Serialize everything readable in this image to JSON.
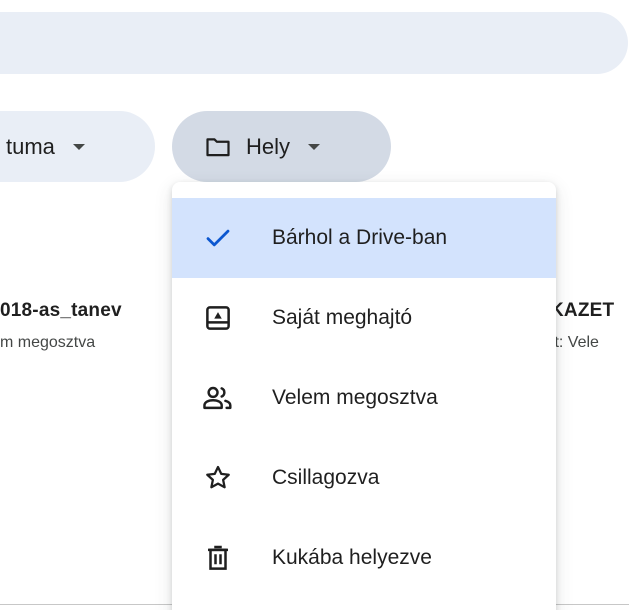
{
  "search": {},
  "filters": {
    "date_chip_label": "tuma",
    "place_chip_label": "Hely"
  },
  "files": {
    "left_name": "018-as_tanev",
    "left_sub": "m megosztva",
    "right_name": "KAZET",
    "right_sub": "tt: Vele"
  },
  "menu": {
    "items": [
      {
        "label": "Bárhol a Drive-ban",
        "icon": "check-icon",
        "selected": true
      },
      {
        "label": "Saját meghajtó",
        "icon": "drive-icon",
        "selected": false
      },
      {
        "label": "Velem megosztva",
        "icon": "people-icon",
        "selected": false
      },
      {
        "label": "Csillagozva",
        "icon": "star-icon",
        "selected": false
      },
      {
        "label": "Kukába helyezve",
        "icon": "trash-icon",
        "selected": false
      }
    ]
  },
  "colors": {
    "chip_bg": "#e9eef6",
    "chip_active_bg": "#d3dae5",
    "selected_bg": "#d3e3fd",
    "accent": "#0b57d0"
  }
}
